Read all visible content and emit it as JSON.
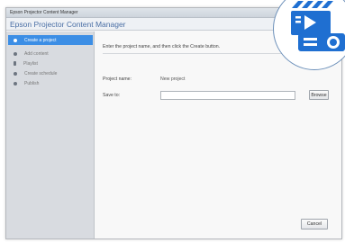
{
  "window": {
    "title_bar": "Epson Projector Content Manager"
  },
  "header": {
    "app_title": "Epson Projector Content Manager"
  },
  "sidebar": {
    "items": [
      {
        "label": "Create a project",
        "active": true
      },
      {
        "label": "Add content",
        "active": false
      },
      {
        "label": "Playlist",
        "active": false
      },
      {
        "label": "Create schedule",
        "active": false
      },
      {
        "label": "Publish",
        "active": false
      }
    ]
  },
  "main": {
    "instruction": "Enter the project name, and then click the Create button.",
    "project_name_label": "Project name:",
    "project_name_value": "New project",
    "folder_label": "Save to:",
    "folder_value": "",
    "browse_label": "Browse",
    "cancel_label": "Cancel"
  },
  "colors": {
    "accent": "#3c8ee5",
    "logo_blue": "#1f6fd1"
  },
  "badge": {
    "icon": "projector-video-icon"
  }
}
